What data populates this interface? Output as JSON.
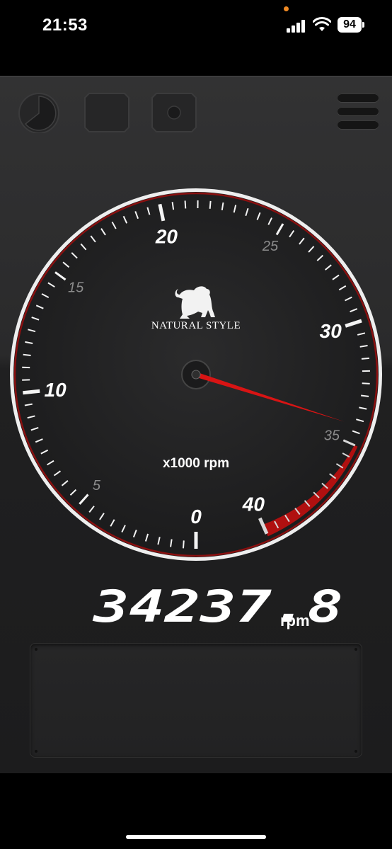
{
  "status_bar": {
    "time": "21:53",
    "battery_level": "94",
    "recording_dot_color": "#f08a24"
  },
  "toolbar": {
    "buttons": [
      {
        "name": "gauge-mode-button",
        "icon": "pie-gauge-icon"
      },
      {
        "name": "display-mode-button",
        "icon": "square-outline-icon"
      },
      {
        "name": "record-button",
        "icon": "record-dot-icon"
      }
    ],
    "menu_icon": "hamburger-menu-icon"
  },
  "gauge": {
    "major_labels": [
      {
        "text": "0",
        "value": 0
      },
      {
        "text": "10",
        "value": 10
      },
      {
        "text": "20",
        "value": 20
      },
      {
        "text": "30",
        "value": 30
      },
      {
        "text": "40",
        "value": 40
      }
    ],
    "minor_labels": [
      {
        "text": "5",
        "value": 5
      },
      {
        "text": "15",
        "value": 15
      },
      {
        "text": "25",
        "value": 25
      },
      {
        "text": "35",
        "value": 35
      }
    ],
    "min": 0,
    "max": 40,
    "redline_start": 35,
    "needle_value": 34.2378,
    "unit_label": "x1000 rpm",
    "brand_text": "NATURAL STYLE",
    "brand_icon": "monkey-logo-icon",
    "needle_color": "#d81414",
    "redline_color": "#b01010"
  },
  "readout": {
    "value": "34237.8",
    "unit": "rpm"
  }
}
